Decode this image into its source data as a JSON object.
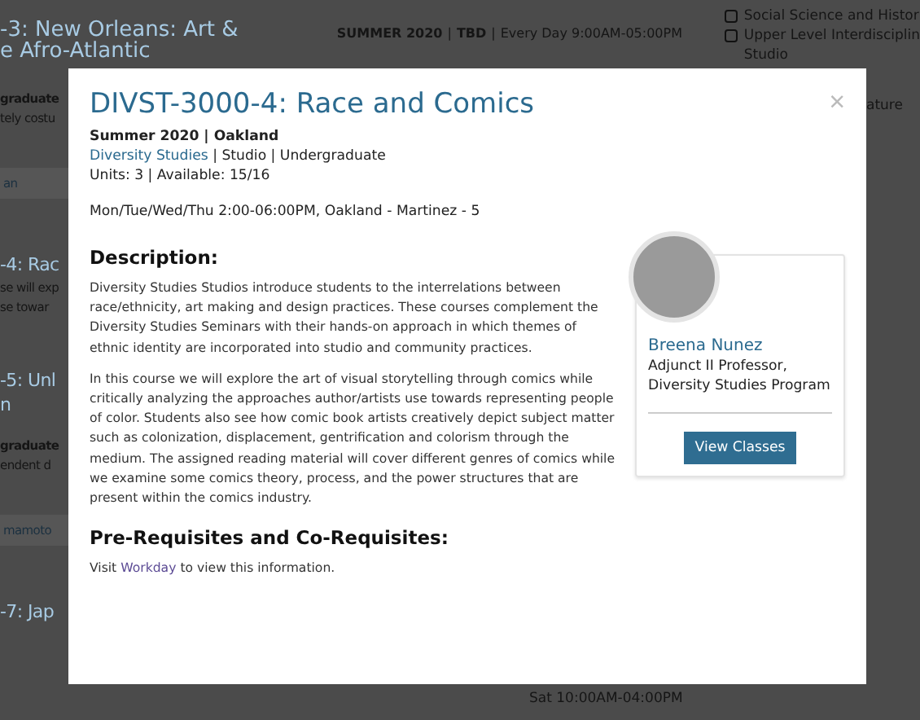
{
  "background": {
    "course_heading": [
      "-3: New Orleans: Art &",
      "e Afro-Atlantic"
    ],
    "schedule": {
      "term": "SUMMER 2020",
      "separator": "|",
      "location": "TBD",
      "time": "Every Day 9:00AM-05:00PM"
    },
    "filters": [
      {
        "label": "Social Science and Histor",
        "checked": false
      },
      {
        "label": "Upper Level Interdisciplin",
        "checked": false,
        "continuation": "Studio"
      }
    ],
    "left_fragments": [
      {
        "kind": "bold",
        "text": "graduate"
      },
      {
        "kind": "text",
        "text": "tely costu"
      },
      {
        "kind": "button",
        "text": "an"
      },
      {
        "kind": "heading",
        "text": "-4: Rac"
      },
      {
        "kind": "text",
        "text": "se will exp"
      },
      {
        "kind": "text",
        "text": "se towar"
      },
      {
        "kind": "heading",
        "text": "-5: Unl"
      },
      {
        "kind": "heading_cont",
        "text": "n"
      },
      {
        "kind": "bold",
        "text": "graduate"
      },
      {
        "kind": "text",
        "text": "endent d"
      },
      {
        "kind": "button",
        "text": "mamoto"
      },
      {
        "kind": "heading",
        "text": "-7: Jap"
      }
    ],
    "right_fragment": "ature",
    "bottom_schedule": "Sat 10:00AM-04:00PM"
  },
  "modal": {
    "title": "DIVST-3000-4: Race and Comics",
    "close": "×",
    "term_campus": "Summer 2020 | Oakland",
    "department": "Diversity Studies",
    "category": "| Studio | Undergraduate",
    "units": "Units: 3 | Available: 15/16",
    "meeting": "Mon/Tue/Wed/Thu 2:00-06:00PM, Oakland - Martinez - 5",
    "description_heading": "Description:",
    "paragraphs": [
      "Diversity Studies Studios introduce students to the interrelations between race/ethnicity, art making and design practices. These courses complement the Diversity Studies Seminars with their hands-on approach in which themes of ethnic identity are incorporated into studio and community practices.",
      "In this course we will explore the art of visual storytelling through comics while critically analyzing the approaches author/artists use towards representing people of color. Students also see how comic book artists creatively depict subject matter such as colonization, displacement, gentrification and colorism through the medium. The assigned reading material will cover different genres of comics while we examine some comics theory, process, and the power structures that are present within the comics industry."
    ],
    "prereq_heading": "Pre-Requisites and Co-Requisites:",
    "prereq": {
      "before": "Visit",
      "link": "Workday",
      "after": "to view this information."
    },
    "instructor": {
      "name": "Breena Nunez",
      "role": "Adjunct II Professor, Diversity Studies Program",
      "button": "View Classes"
    }
  }
}
